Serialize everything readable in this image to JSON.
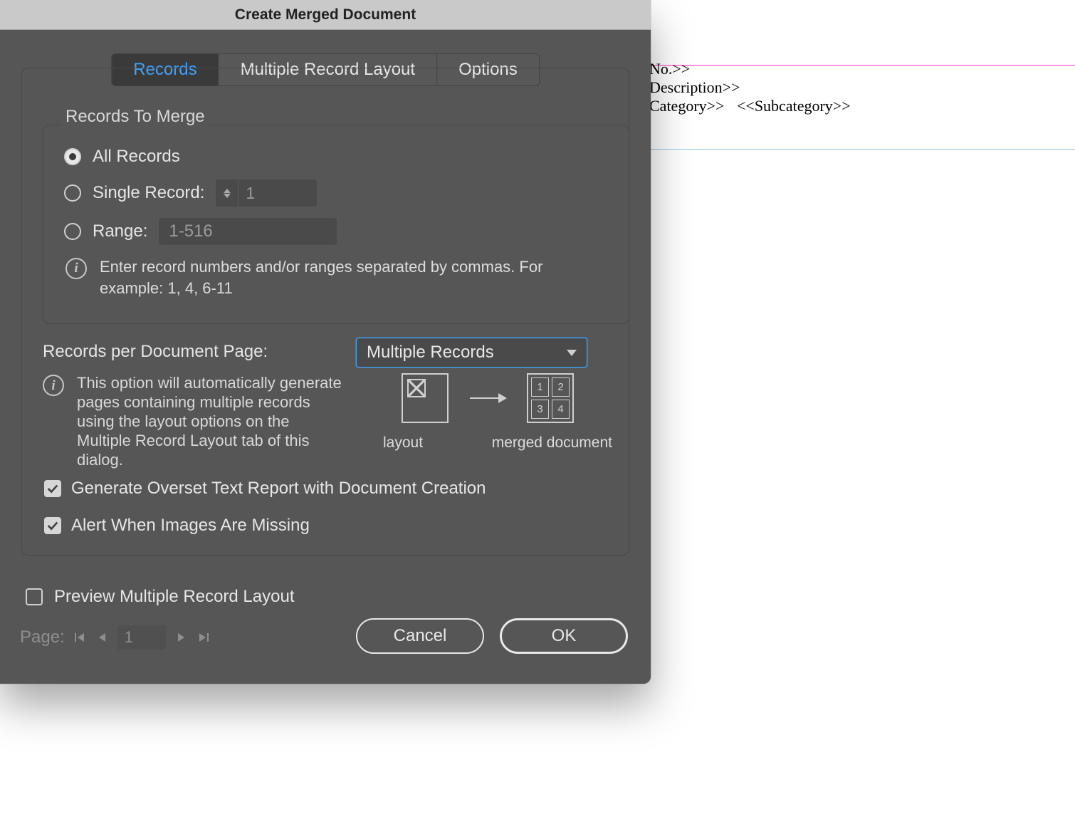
{
  "dialog_title": "Create Merged Document",
  "tabs": {
    "records": "Records",
    "layout": "Multiple Record Layout",
    "options": "Options"
  },
  "records_merge": {
    "legend": "Records To Merge",
    "all": "All Records",
    "single": "Single Record:",
    "single_value": "1",
    "range": "Range:",
    "range_value": "1-516",
    "hint": "Enter record numbers and/or ranges separated by commas. For example: 1, 4, 6-11"
  },
  "rpp": {
    "label": "Records per Document Page:",
    "value": "Multiple Records",
    "hint": "This option will automatically generate pages containing multiple records using the layout options on the Multiple Record Layout tab of this dialog.",
    "cap_layout": "layout",
    "cap_merged": "merged document"
  },
  "checks": {
    "overset": "Generate Overset Text Report with Document Creation",
    "alert": "Alert When Images Are Missing"
  },
  "preview_label": "Preview Multiple Record Layout",
  "page": {
    "label": "Page:",
    "value": "1"
  },
  "buttons": {
    "cancel": "Cancel",
    "ok": "OK"
  },
  "canvas": {
    "f1": "No.>>",
    "f2": "Description>>",
    "f3": "Category>>",
    "f4": "<<Subcategory>>"
  }
}
